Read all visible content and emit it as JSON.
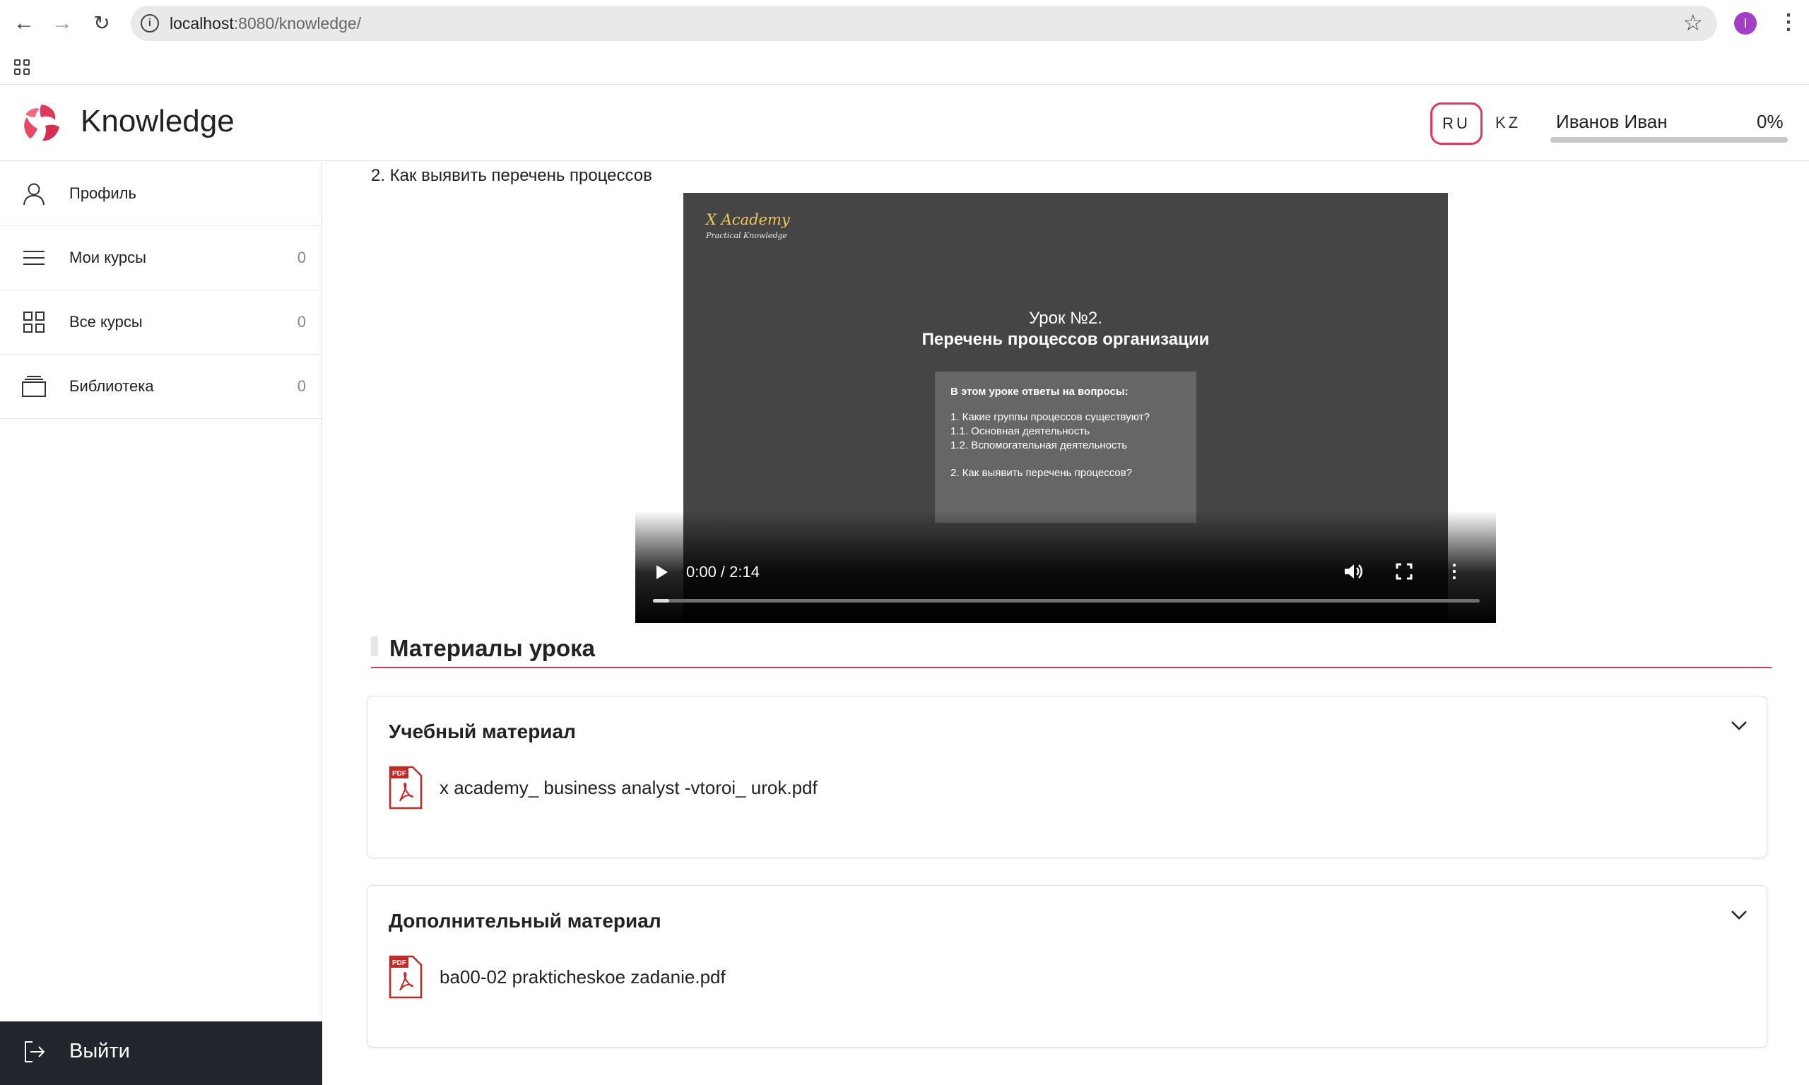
{
  "browser": {
    "url_host": "localhost",
    "url_rest": ":8080/knowledge/",
    "profile_initial": "I"
  },
  "header": {
    "brand": "Knowledge",
    "lang_ru": "RU",
    "lang_kz": "KZ",
    "user_name": "Иванов Иван",
    "progress_text": "0%",
    "progress_value": 0,
    "accent": "#e0385d"
  },
  "sidebar": {
    "items": [
      {
        "label": "Профиль",
        "count": "",
        "icon": "user-icon"
      },
      {
        "label": "Мои курсы",
        "count": "0",
        "icon": "list-icon"
      },
      {
        "label": "Все курсы",
        "count": "0",
        "icon": "grid-icon"
      },
      {
        "label": "Библиотека",
        "count": "0",
        "icon": "library-icon"
      }
    ],
    "logout_label": "Выйти"
  },
  "main": {
    "question": "2. Как выявить перечень процессов",
    "video": {
      "slide_logo": "X Academy",
      "slide_logo_sub": "Practical Knowledge",
      "slide_title": "Урок №2.",
      "slide_subtitle": "Перечень процессов организации",
      "box_heading": "В этом уроке ответы на вопросы:",
      "box_lines": [
        "1. Какие группы процессов существуют?",
        "1.1. Основная деятельность",
        "1.2. Вспомогательная деятельность",
        "2. Как выявить перечень процессов?"
      ],
      "time": "0:00 / 2:14",
      "played_fraction": 0.02
    },
    "materials_title": "Материалы урока",
    "cards": [
      {
        "title": "Учебный материал",
        "file": "x academy_ business analyst -vtoroi_ urok.pdf"
      },
      {
        "title": "Дополнительный материал",
        "file": "ba00-02 prakticheskoe zadanie.pdf"
      }
    ]
  }
}
